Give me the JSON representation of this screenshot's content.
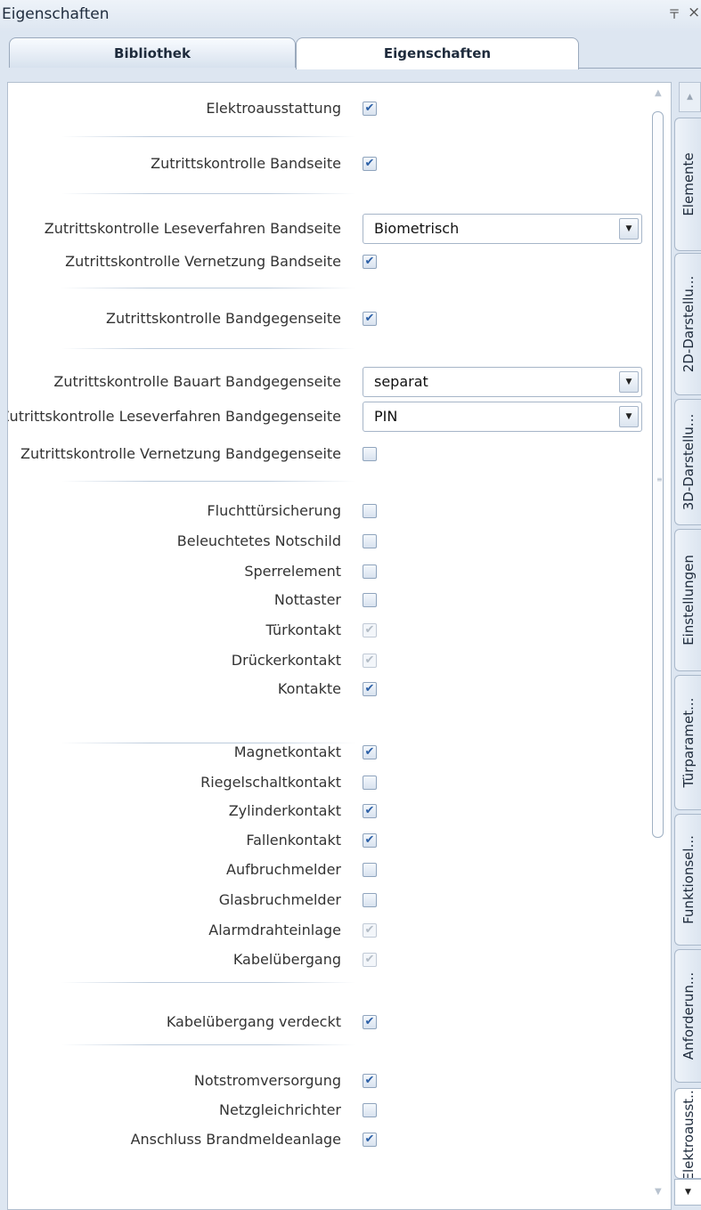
{
  "window": {
    "title": "Eigenschaften",
    "pin_glyph": "〒",
    "close_glyph": "×"
  },
  "tabs": [
    {
      "label": "Bibliothek",
      "active": false
    },
    {
      "label": "Eigenschaften",
      "active": true
    }
  ],
  "properties": [
    {
      "label": "Elektroausstattung",
      "kind": "checkbox",
      "checked": true,
      "enabled": true
    },
    {
      "label": "Zutrittskontrolle Bandseite",
      "kind": "checkbox",
      "checked": true,
      "enabled": true
    },
    {
      "label": "Zutrittskontrolle Leseverfahren Bandseite",
      "kind": "dropdown",
      "value": "Biometrisch"
    },
    {
      "label": "Zutrittskontrolle Vernetzung Bandseite",
      "kind": "checkbox",
      "checked": true,
      "enabled": true
    },
    {
      "label": "Zutrittskontrolle Bandgegenseite",
      "kind": "checkbox",
      "checked": true,
      "enabled": true
    },
    {
      "label": "Zutrittskontrolle Bauart Bandgegenseite",
      "kind": "dropdown",
      "value": "separat"
    },
    {
      "label": "Zutrittskontrolle Leseverfahren Bandgegenseite",
      "kind": "dropdown",
      "value": "PIN"
    },
    {
      "label": "Zutrittskontrolle Vernetzung Bandgegenseite",
      "kind": "checkbox",
      "checked": false,
      "enabled": true
    },
    {
      "label": "Fluchttürsicherung",
      "kind": "checkbox",
      "checked": false,
      "enabled": true
    },
    {
      "label": "Beleuchtetes Notschild",
      "kind": "checkbox",
      "checked": false,
      "enabled": true
    },
    {
      "label": "Sperrelement",
      "kind": "checkbox",
      "checked": false,
      "enabled": true
    },
    {
      "label": "Nottaster",
      "kind": "checkbox",
      "checked": false,
      "enabled": true
    },
    {
      "label": "Türkontakt",
      "kind": "checkbox",
      "checked": true,
      "enabled": false
    },
    {
      "label": "Drückerkontakt",
      "kind": "checkbox",
      "checked": true,
      "enabled": false
    },
    {
      "label": "Kontakte",
      "kind": "checkbox",
      "checked": true,
      "enabled": true
    },
    {
      "label": "Magnetkontakt",
      "kind": "checkbox",
      "checked": true,
      "enabled": true
    },
    {
      "label": "Riegelschaltkontakt",
      "kind": "checkbox",
      "checked": false,
      "enabled": true
    },
    {
      "label": "Zylinderkontakt",
      "kind": "checkbox",
      "checked": true,
      "enabled": true
    },
    {
      "label": "Fallenkontakt",
      "kind": "checkbox",
      "checked": true,
      "enabled": true
    },
    {
      "label": "Aufbruchmelder",
      "kind": "checkbox",
      "checked": false,
      "enabled": true
    },
    {
      "label": "Glasbruchmelder",
      "kind": "checkbox",
      "checked": false,
      "enabled": true
    },
    {
      "label": "Alarmdrahteinlage",
      "kind": "checkbox",
      "checked": true,
      "enabled": false
    },
    {
      "label": "Kabelübergang",
      "kind": "checkbox",
      "checked": true,
      "enabled": false
    },
    {
      "label": "Kabelübergang verdeckt",
      "kind": "checkbox",
      "checked": true,
      "enabled": true
    },
    {
      "label": "Notstromversorgung",
      "kind": "checkbox",
      "checked": true,
      "enabled": true
    },
    {
      "label": "Netzgleichrichter",
      "kind": "checkbox",
      "checked": false,
      "enabled": true
    },
    {
      "label": "Anschluss Brandmeldeanlage",
      "kind": "checkbox",
      "checked": true,
      "enabled": true
    }
  ],
  "side_tabs": [
    {
      "label": "Elemente",
      "active": false
    },
    {
      "label": "2D-Darstellu...",
      "active": false
    },
    {
      "label": "3D-Darstellu...",
      "active": false
    },
    {
      "label": "Einstellungen",
      "active": false
    },
    {
      "label": "Türparamet...",
      "active": false
    },
    {
      "label": "Funktionsel...",
      "active": false
    },
    {
      "label": "Anforderun...",
      "active": false
    },
    {
      "label": "Elektroausst...",
      "active": true
    }
  ],
  "glyphs": {
    "check": "✔",
    "dropdown_arrow": "▼",
    "scroll_up": "▲",
    "scroll_down": "▼",
    "grip": "≡"
  }
}
